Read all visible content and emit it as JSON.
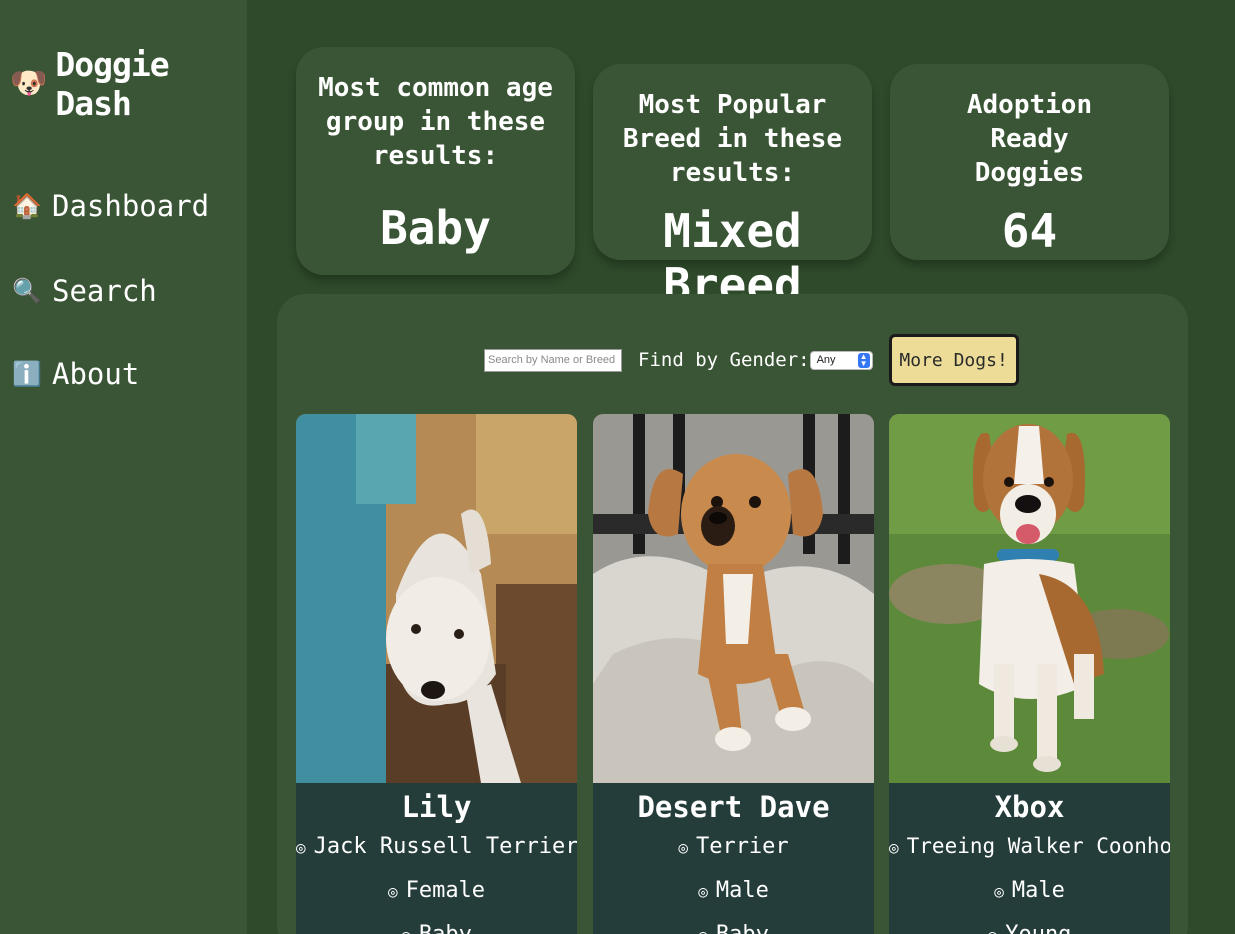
{
  "sidebar": {
    "brand": {
      "emoji": "🐶",
      "title": "Doggie Dash"
    },
    "items": [
      {
        "emoji": "🏠",
        "label": "Dashboard"
      },
      {
        "emoji": "🔍",
        "label": "Search"
      },
      {
        "emoji": "ℹ️",
        "label": "About"
      }
    ]
  },
  "stats": [
    {
      "label": "Most common age group in these results:",
      "value": "Baby"
    },
    {
      "label": "Most Popular Breed in these results:",
      "value": "Mixed Breed"
    },
    {
      "label": "Adoption Ready Doggies",
      "value": "64"
    }
  ],
  "controls": {
    "search_placeholder": "Search by Name or Breed",
    "gender_label": "Find by Gender:",
    "gender_selected": "Any",
    "more_button": "More Dogs!"
  },
  "dogs": [
    {
      "name": "Lily",
      "breed": "Jack Russell Terrier",
      "gender": "Female",
      "age": "Baby"
    },
    {
      "name": "Desert Dave",
      "breed": "Terrier",
      "gender": "Male",
      "age": "Baby"
    },
    {
      "name": "Xbox",
      "breed": "Treeing Walker Coonhound",
      "gender": "Male",
      "age": "Young"
    }
  ],
  "colors": {
    "page_bg": "#2e4a2a",
    "panel_bg": "#3a5535",
    "card_info_bg": "#243d3a",
    "button_bg": "#ecdc98"
  }
}
